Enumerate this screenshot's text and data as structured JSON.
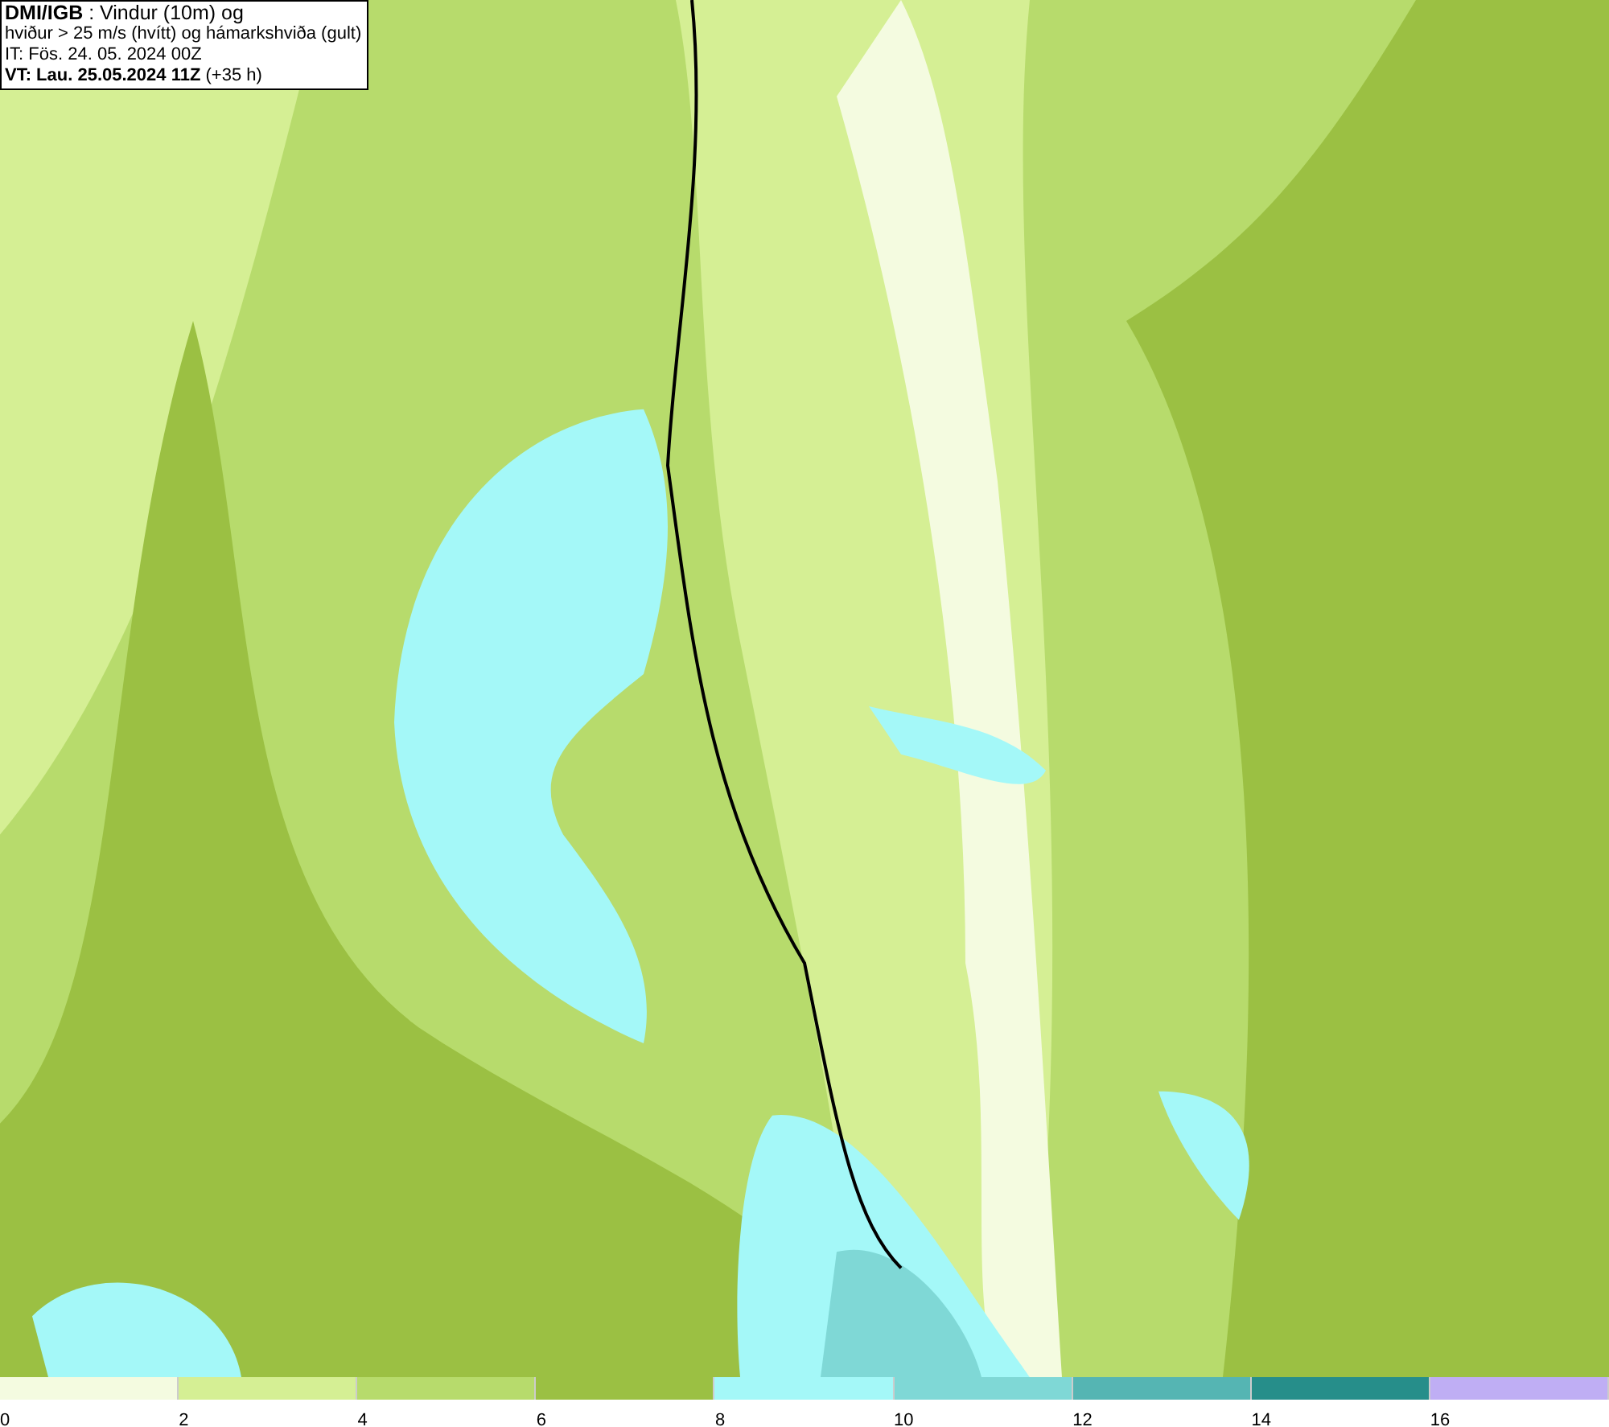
{
  "info_box": {
    "lines": [
      "**DMI/IGB** : Vindur (10m) og",
      "hviður > 25 m/s (hvítt) og hámarkshviða (gult)",
      "IT: Fös. 24. 05. 2024 00Z",
      "**VT: Lau. 25.05.2024 11Z** (+35 h)"
    ]
  },
  "legend": [
    {
      "label": "0",
      "color": "#f4fbe0"
    },
    {
      "label": "2",
      "color": "#d5ef94"
    },
    {
      "label": "4",
      "color": "#b7db6c"
    },
    {
      "label": "6",
      "color": "#9bc043"
    },
    {
      "label": "8",
      "color": "#a4f8f8"
    },
    {
      "label": "10",
      "color": "#7fd8d6"
    },
    {
      "label": "12",
      "color": "#55b5b3"
    },
    {
      "label": "14",
      "color": "#268e8a"
    },
    {
      "label": "16",
      "color": "#bfaef4"
    }
  ]
}
